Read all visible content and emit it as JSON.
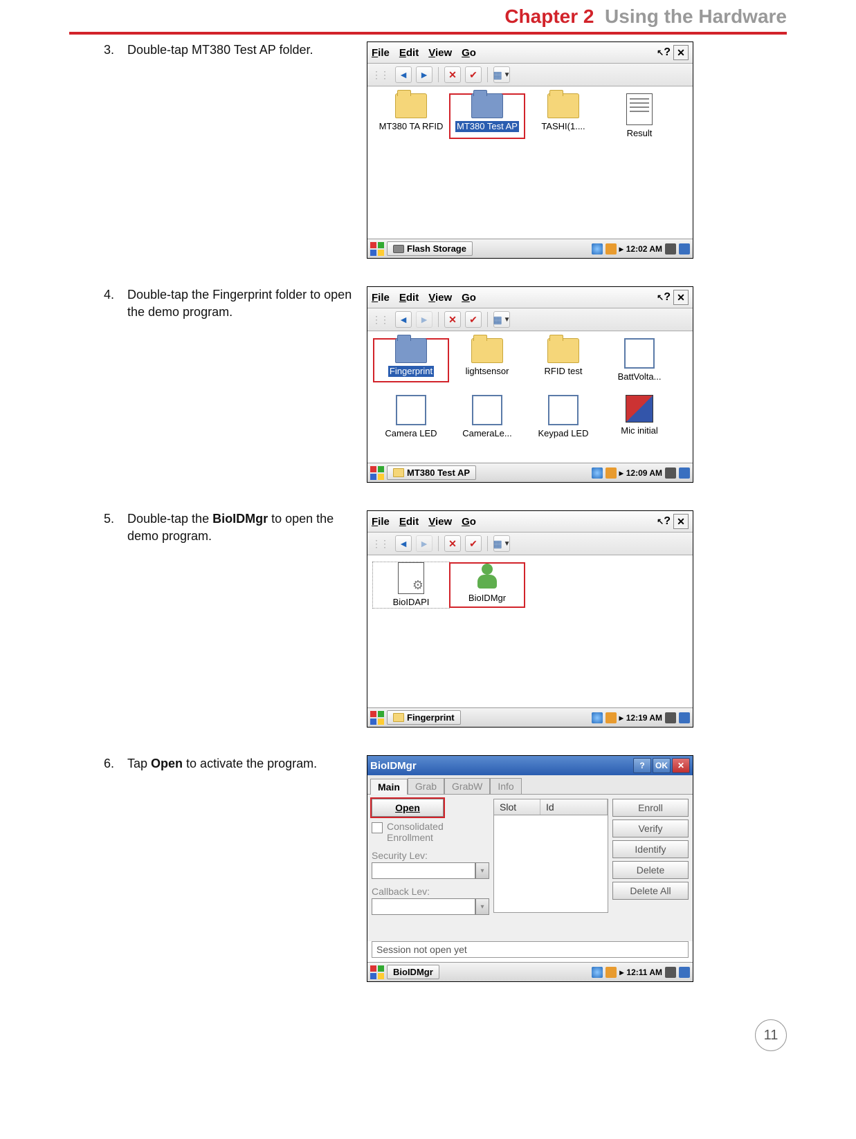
{
  "header": {
    "chapter": "Chapter 2",
    "title": "Using the Hardware"
  },
  "steps": [
    {
      "num": "3.",
      "plain": "Double-tap MT380 Test AP folder."
    },
    {
      "num": "4.",
      "plain": "Double-tap the Fingerprint folder to open the demo program."
    },
    {
      "num": "5.",
      "pre": "Double-tap the ",
      "bold": "BioIDMgr",
      "post": " to open the demo program."
    },
    {
      "num": "6.",
      "pre": "Tap ",
      "bold": "Open",
      "post": " to activate the program."
    }
  ],
  "menus": {
    "file_u": "F",
    "file": "ile",
    "edit_u": "E",
    "edit": "dit",
    "view_u": "V",
    "view": "iew",
    "go_u": "G",
    "go": "o",
    "help": "?",
    "close": "✕"
  },
  "shot1": {
    "icons": [
      {
        "label": "MT380 TA RFID",
        "type": "folder"
      },
      {
        "label": "MT380 Test AP",
        "type": "folder-blue",
        "sel": true
      },
      {
        "label": "TASHI(1....",
        "type": "folder"
      },
      {
        "label": "Result",
        "type": "doc"
      }
    ],
    "task": "Flash Storage",
    "time": "12:02 AM"
  },
  "shot2": {
    "row1": [
      {
        "label": "Fingerprint",
        "type": "folder-blue",
        "sel": true
      },
      {
        "label": "lightsensor",
        "type": "folder"
      },
      {
        "label": "RFID test",
        "type": "folder"
      },
      {
        "label": "BattVolta...",
        "type": "app"
      }
    ],
    "row2": [
      {
        "label": "Camera LED",
        "type": "app"
      },
      {
        "label": "CameraLe...",
        "type": "app"
      },
      {
        "label": "Keypad LED",
        "type": "app"
      },
      {
        "label": "Mic initial",
        "type": "cube"
      }
    ],
    "task": "MT380 Test AP",
    "time": "12:09 AM"
  },
  "shot3": {
    "icons": [
      {
        "label": "BioIDAPI",
        "type": "cfg",
        "boxed": true
      },
      {
        "label": "BioIDMgr",
        "type": "person",
        "red": true
      }
    ],
    "task": "Fingerprint",
    "time": "12:19 AM"
  },
  "shot4": {
    "title": "BioIDMgr",
    "help": "?",
    "ok": "OK",
    "close": "✕",
    "tabs": [
      "Main",
      "Grab",
      "GrabW",
      "Info"
    ],
    "open": "Open",
    "consolidated": "Consolidated Enrollment",
    "seclev": "Security Lev:",
    "cblev": "Callback Lev:",
    "cols": [
      "Slot",
      "Id"
    ],
    "buttons": [
      "Enroll",
      "Verify",
      "Identify",
      "Delete",
      "Delete All"
    ],
    "status": "Session not open yet",
    "task": "BioIDMgr",
    "time": "12:11 AM"
  },
  "page_number": "11"
}
